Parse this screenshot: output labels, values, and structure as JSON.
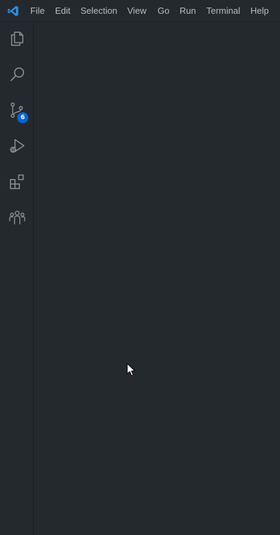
{
  "app": {
    "logo_icon": "vscode-logo-icon",
    "accent_color": "#2a8fe6"
  },
  "menubar": {
    "items": [
      "File",
      "Edit",
      "Selection",
      "View",
      "Go",
      "Run",
      "Terminal",
      "Help"
    ]
  },
  "activitybar": {
    "items": [
      {
        "name": "explorer",
        "icon": "files-icon"
      },
      {
        "name": "search",
        "icon": "search-icon"
      },
      {
        "name": "source-control",
        "icon": "source-control-icon",
        "badge": "6"
      },
      {
        "name": "run-and-debug",
        "icon": "run-debug-icon"
      },
      {
        "name": "extensions",
        "icon": "extensions-icon"
      },
      {
        "name": "live-share",
        "icon": "people-icon"
      }
    ],
    "badge_color": "#0366d6"
  },
  "editor": {
    "background": "#24292e"
  }
}
